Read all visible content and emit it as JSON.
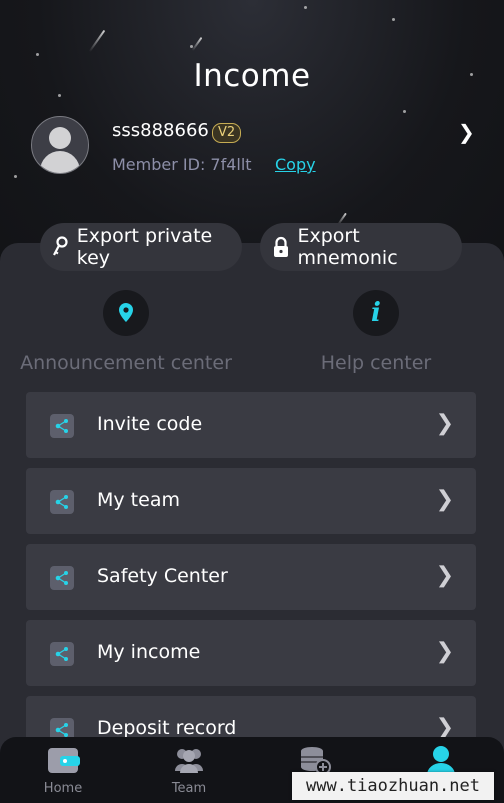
{
  "header": {
    "title": "Income"
  },
  "profile": {
    "username": "sss888666",
    "level_badge": "V2",
    "member_id_label": "Member ID:",
    "member_id": "7f4llt",
    "copy_label": "Copy"
  },
  "actions": {
    "export_key_label": "Export private key",
    "export_mnemonic_label": "Export mnemonic"
  },
  "quick_links": [
    {
      "label": "Announcement center",
      "icon": "location-pin-icon"
    },
    {
      "label": "Help center",
      "icon": "info-icon"
    }
  ],
  "menu": [
    {
      "label": "Invite code",
      "icon": "share-icon"
    },
    {
      "label": "My team",
      "icon": "share-icon"
    },
    {
      "label": "Safety Center",
      "icon": "share-icon"
    },
    {
      "label": "My income",
      "icon": "share-icon"
    },
    {
      "label": "Deposit record",
      "icon": "share-icon"
    }
  ],
  "tabs": [
    {
      "label": "Home",
      "icon": "wallet-icon"
    },
    {
      "label": "Team",
      "icon": "team-icon"
    },
    {
      "label": "",
      "icon": "coins-add-icon"
    },
    {
      "label": "",
      "icon": "user-icon",
      "active": true
    }
  ],
  "watermark": "www.tiaozhuan.net",
  "colors": {
    "accent": "#27d3e8",
    "badge": "#e9d07a",
    "panel": "#2b2c33",
    "item": "#3a3b43"
  }
}
